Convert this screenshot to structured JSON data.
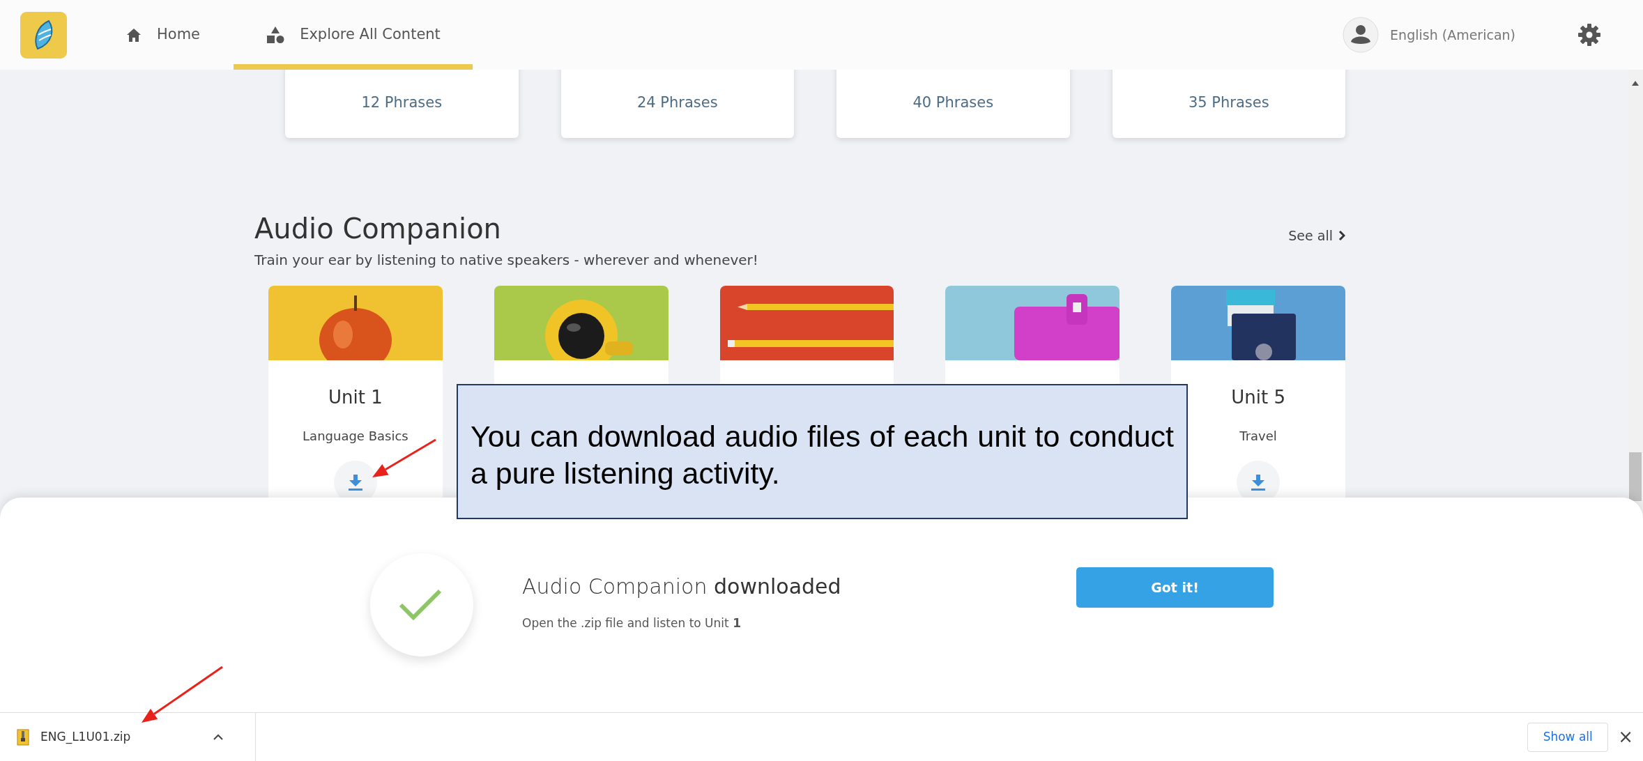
{
  "nav": {
    "tabs": [
      {
        "label": "Home",
        "selected": false
      },
      {
        "label": "Explore All Content",
        "selected": true
      }
    ],
    "language": "English (American)"
  },
  "phrase_cards": [
    {
      "count": "12 Phrases"
    },
    {
      "count": "24 Phrases"
    },
    {
      "count": "40 Phrases"
    },
    {
      "count": "35 Phrases"
    }
  ],
  "section": {
    "title": "Audio Companion",
    "subtitle": "Train your ear by listening to native speakers - wherever and whenever!",
    "see_all": "See all"
  },
  "units": [
    {
      "kind": "picture",
      "title": "Unit 1",
      "subtitle": "Language Basics",
      "download": true
    },
    {
      "kind": "picture"
    },
    {
      "kind": "picture"
    },
    {
      "kind": "picture"
    },
    {
      "kind": "picture",
      "title": "Unit 5",
      "subtitle": "Travel",
      "download": true
    }
  ],
  "toast": {
    "title": "Audio Companion **downloaded**",
    "text": "Open the .zip file and listen to Unit **1**",
    "button": "Got it!"
  },
  "annotation": {
    "text": "You can download audio files of each unit to conduct a pure listening activity."
  },
  "download_bar": {
    "file": "ENG_L1U01.zip",
    "show_all": "Show all",
    "close": "×"
  }
}
